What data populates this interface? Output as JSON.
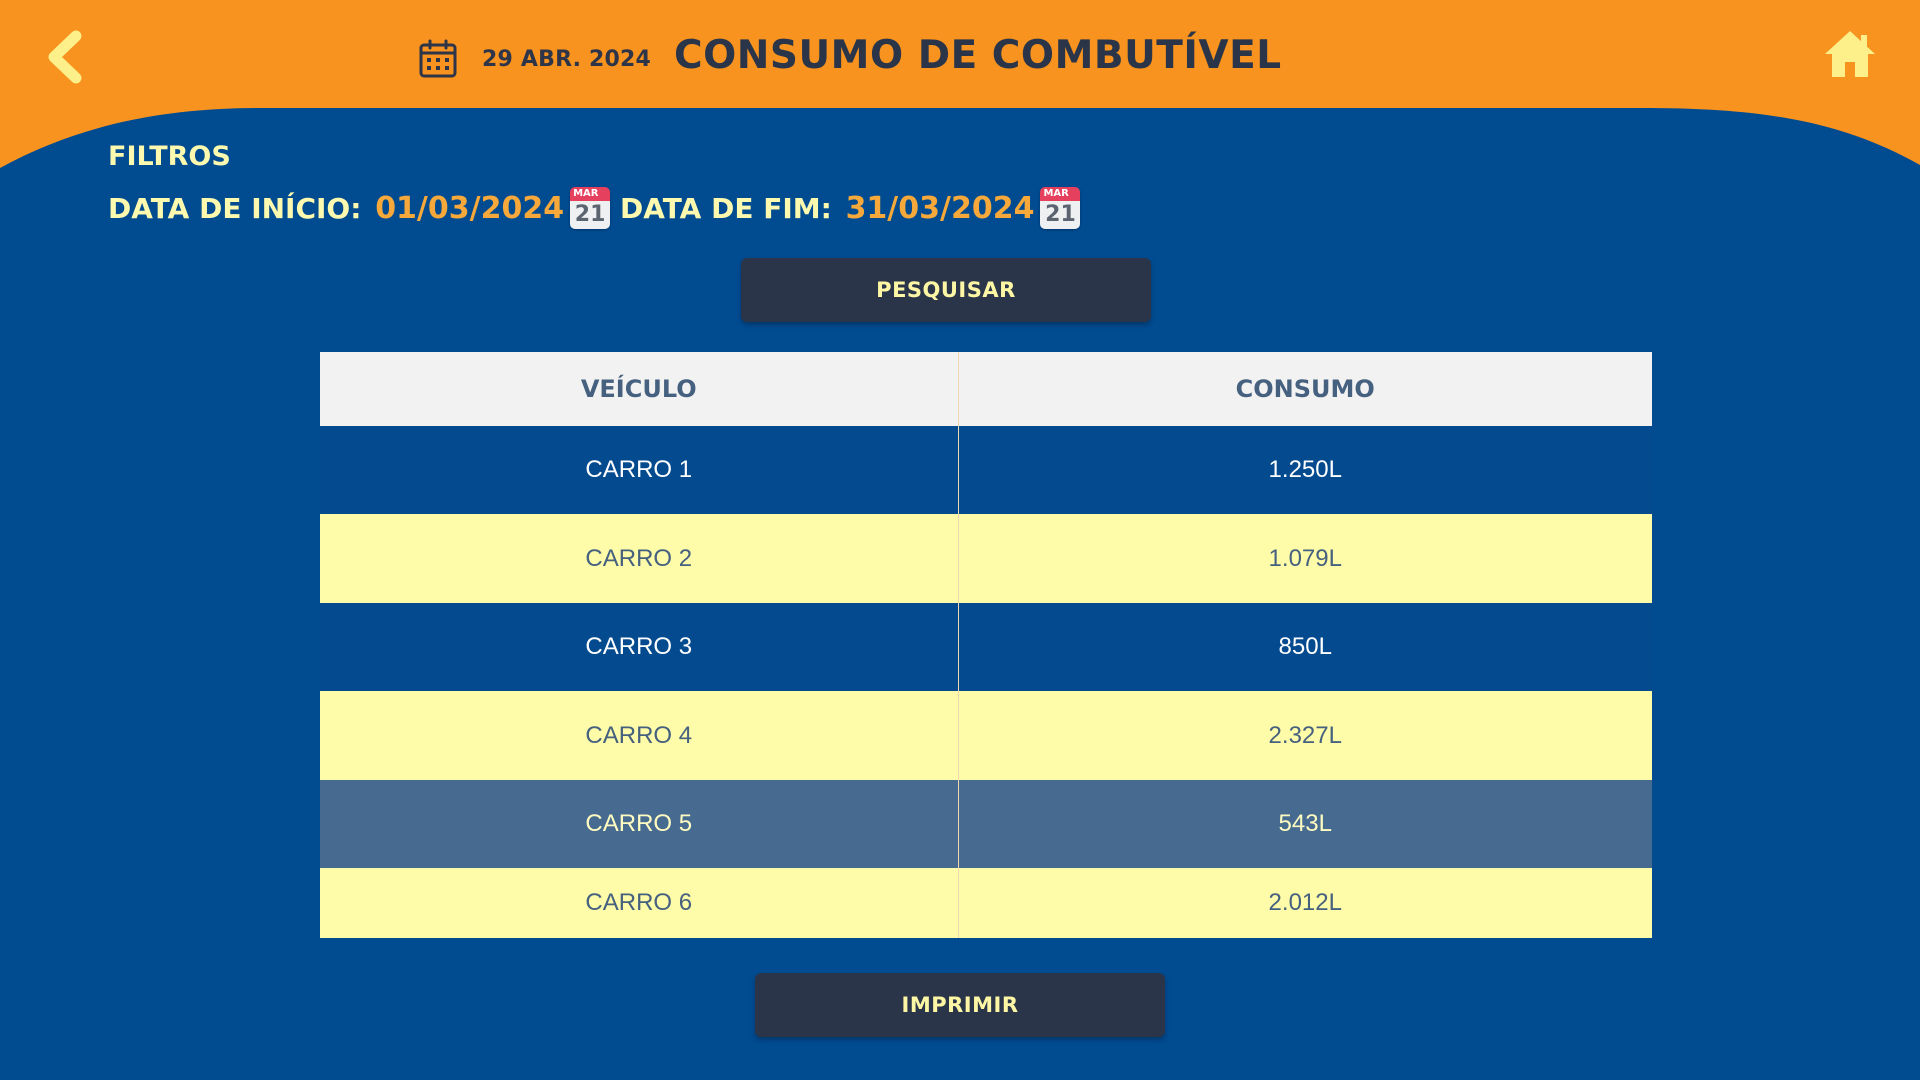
{
  "header": {
    "current_date": "29 ABR. 2024",
    "title": "CONSUMO DE COMBUTÍVEL",
    "back_icon": "chevron-left-icon",
    "home_icon": "home-icon",
    "calendar_icon": "calendar-icon"
  },
  "filters": {
    "title": "FILTROS",
    "start_label": "DATA DE INÍCIO: ",
    "start_value": "01/03/2024",
    "end_label": "DATA DE FIM: ",
    "end_value": "31/03/2024",
    "picker_month": "MAR",
    "picker_day": "21",
    "picker_icon": "calendar-date-icon"
  },
  "search_button": "PESQUISAR",
  "table": {
    "columns": [
      "VEÍCULO",
      "CONSUMO"
    ],
    "rows": [
      {
        "vehicle": "CARRO 1",
        "consumption": "1.250L"
      },
      {
        "vehicle": "CARRO 2",
        "consumption": "1.079L"
      },
      {
        "vehicle": "CARRO 3",
        "consumption": "850L"
      },
      {
        "vehicle": "CARRO 4",
        "consumption": "2.327L"
      },
      {
        "vehicle": "CARRO 5",
        "consumption": "543L"
      },
      {
        "vehicle": "CARRO 6",
        "consumption": "2.012L"
      }
    ]
  },
  "print_button": "IMPRIMIR",
  "colors": {
    "header_orange": "#f7931e",
    "background_blue": "#014b91",
    "accent_yellow": "#fdfab0",
    "date_orange": "#f6a93a",
    "button_dark": "#2b3549",
    "row_yellow": "#fefca8",
    "row_selected": "#476a91"
  }
}
